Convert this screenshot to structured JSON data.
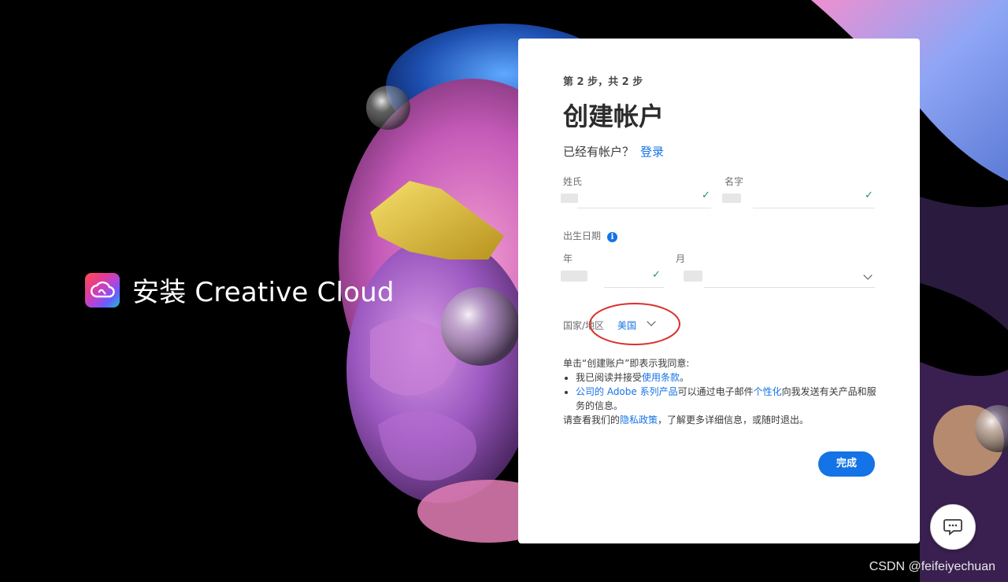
{
  "brand": {
    "title": "安装 Creative Cloud"
  },
  "form": {
    "step": "第 2 步，共 2 步",
    "title": "创建帐户",
    "have_account": "已经有帐户？",
    "signin_link": "登录",
    "last_name_label": "姓氏",
    "first_name_label": "名字",
    "dob_label": "出生日期",
    "year_label": "年",
    "month_label": "月",
    "country_label": "国家/地区",
    "country_value": "美国",
    "terms_intro": "单击“创建账户”即表示我同意:",
    "terms_item1_prefix": "我已阅读并接受",
    "terms_item1_link": "使用条款",
    "terms_item1_suffix": "。",
    "terms_item2_link1": "公司的 Adobe 系列产品",
    "terms_item2_mid": "可以通过电子邮件",
    "terms_item2_link2": "个性化",
    "terms_item2_suffix": "向我发送有关产品和服务的信息。",
    "privacy_prefix": "请查看我们的",
    "privacy_link": "隐私政策",
    "privacy_suffix": "，了解更多详细信息，或随时退出。",
    "done_button": "完成"
  },
  "watermark": "CSDN @feifeiyechuan",
  "colors": {
    "accent": "#1473e6",
    "valid": "#268e6c",
    "annotation": "#d9312b"
  },
  "icons": {
    "chat": "chat-bubble-icon",
    "info": "info-icon",
    "check": "checkmark-icon",
    "dropdown": "chevron-down-icon"
  }
}
